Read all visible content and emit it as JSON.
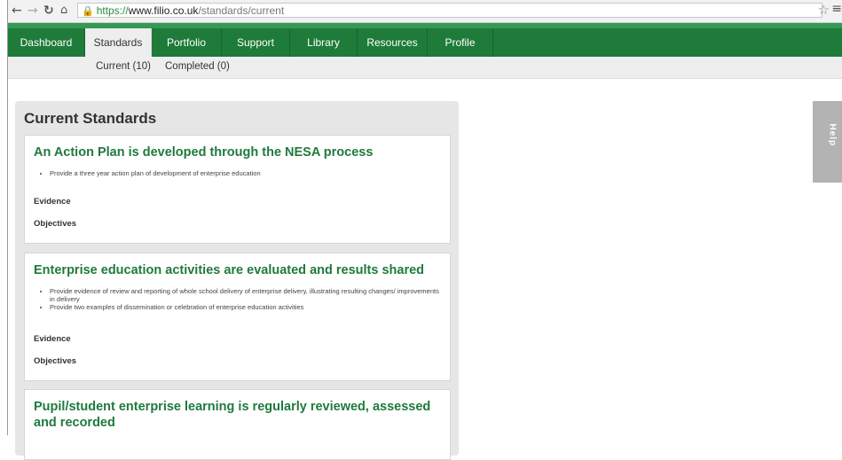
{
  "browser": {
    "url_scheme": "https://",
    "url_host": "www.filio.co.uk",
    "url_path": "/standards/current"
  },
  "topnav": [
    {
      "label": "Dashboard",
      "active": false
    },
    {
      "label": "Standards",
      "active": true
    },
    {
      "label": "Portfolio",
      "active": false
    },
    {
      "label": "Support",
      "active": false
    },
    {
      "label": "Library",
      "active": false
    },
    {
      "label": "Resources",
      "active": false
    },
    {
      "label": "Profile",
      "active": false
    }
  ],
  "subnav": {
    "current": "Current (10)",
    "completed": "Completed (0)"
  },
  "main": {
    "title": "Current Standards",
    "standards": [
      {
        "title": "An Action Plan is developed through the NESA process",
        "bullets": [
          "Provide a three year action plan of development of enterprise education"
        ],
        "evidence_label": "Evidence",
        "objectives_label": "Objectives"
      },
      {
        "title": "Enterprise education activities are evaluated and results shared",
        "bullets": [
          "Provide evidence of review and reporting of whole school delivery of enterprise delivery, illustrating resulting changes/ improvements in delivery",
          "Provide two examples of dissemination or celebration of enterprise education activities"
        ],
        "evidence_label": "Evidence",
        "objectives_label": "Objectives"
      },
      {
        "title": "Pupil/student enterprise learning is regularly reviewed, assessed and recorded"
      }
    ]
  },
  "help": {
    "label": "Help"
  },
  "icons": {
    "back": "arrow-left-icon",
    "forward": "arrow-right-icon",
    "reload": "reload-icon",
    "home": "home-icon",
    "lock": "lock-icon",
    "star": "star-icon",
    "menu": "menu-icon"
  }
}
